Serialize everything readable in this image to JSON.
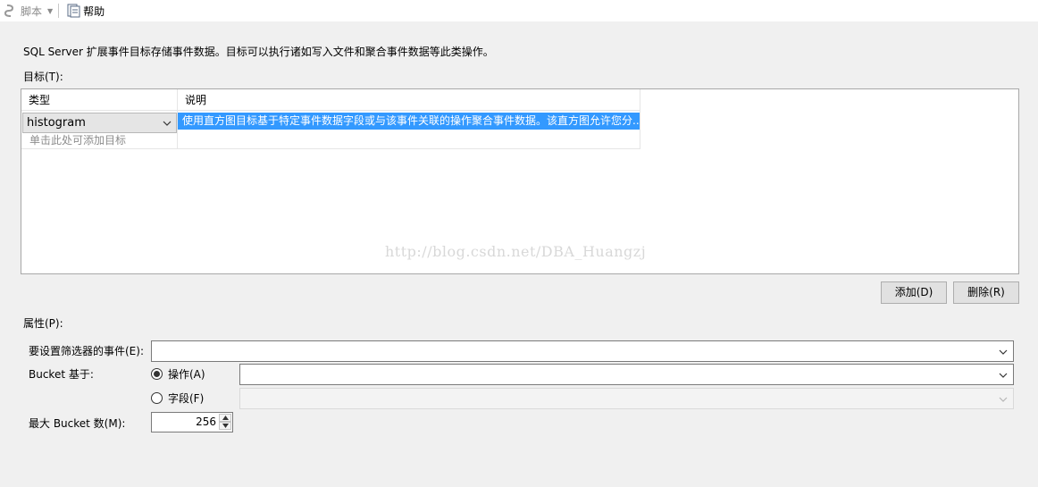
{
  "toolbar": {
    "script_label": "脚本",
    "help_label": "帮助"
  },
  "description": "SQL Server 扩展事件目标存储事件数据。目标可以执行诸如写入文件和聚合事件数据等此类操作。",
  "targets": {
    "label": "目标(T):",
    "columns": [
      "类型",
      "说明"
    ],
    "rows": [
      {
        "type": "histogram",
        "description": "使用直方图目标基于特定事件数据字段或与该事件关联的操作聚合事件数据。该直方图允许您分..."
      }
    ],
    "add_hint": "单击此处可添加目标"
  },
  "watermark": "http://blog.csdn.net/DBA_Huangzj",
  "buttons": {
    "add": "添加(D)",
    "delete": "删除(R)"
  },
  "properties": {
    "label": "属性(P):",
    "filter_event_label": "要设置筛选器的事件(E):",
    "filter_event_value": "",
    "bucket_based_label": "Bucket 基于:",
    "radio_action_label": "操作(A)",
    "radio_field_label": "字段(F)",
    "selected_radio": "操作(A)",
    "action_value": "",
    "field_value": "",
    "max_bucket_label": "最大 Bucket 数(M):",
    "max_bucket_value": "256"
  },
  "colors": {
    "selection": "#3399ff",
    "window_bg": "#f0f0f0"
  },
  "icons": {
    "script": "script-icon",
    "help": "help-document-icon",
    "dropdown": "chevron-down-icon"
  }
}
